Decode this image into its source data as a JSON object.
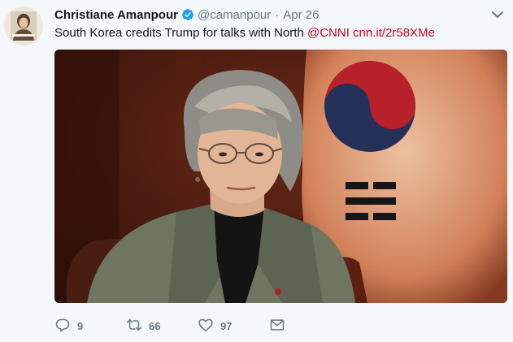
{
  "tweet": {
    "author_name": "Christiane Amanpour",
    "handle": "@camanpour",
    "separator": "·",
    "time": "Apr 26",
    "text": "South Korea credits Trump for talks with North ",
    "mention": "@CNNI",
    "link": "cnn.it/2r58XMe"
  },
  "actions": {
    "reply_count": "9",
    "retweet_count": "66",
    "like_count": "97"
  },
  "colors": {
    "link": "#d0021b",
    "verified": "#1da1f2",
    "muted": "#657786",
    "background": "#f5f8fa"
  },
  "icons": [
    "verified-badge-icon",
    "chevron-down-icon",
    "reply-icon",
    "retweet-icon",
    "like-icon",
    "direct-message-icon"
  ]
}
